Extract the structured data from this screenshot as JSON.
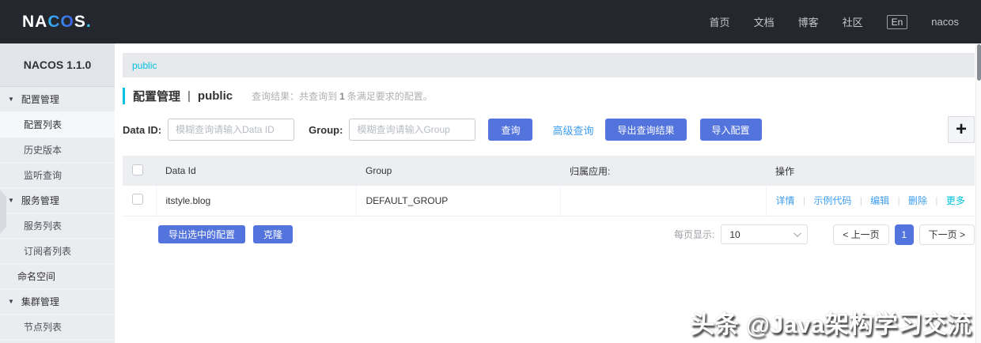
{
  "colors": {
    "topbar-bg": "#24282e",
    "accent": "#5373dd",
    "link": "#3d9df0",
    "cyan": "#00c1de",
    "sidebar-bg": "#eaecf0",
    "table-header-bg": "#eceef1"
  },
  "topbar": {
    "logo": {
      "na": "NA",
      "co": "CO",
      "s": "S",
      "dot": "."
    },
    "links": [
      "首页",
      "文档",
      "博客",
      "社区"
    ],
    "lang": "En",
    "user": "nacos"
  },
  "sidebar": {
    "version": "NACOS 1.1.0",
    "caret": "▼",
    "items": [
      {
        "label": "配置管理",
        "type": "group"
      },
      {
        "label": "配置列表",
        "type": "sub",
        "selected": true
      },
      {
        "label": "历史版本",
        "type": "sub"
      },
      {
        "label": "监听查询",
        "type": "sub"
      },
      {
        "label": "服务管理",
        "type": "group"
      },
      {
        "label": "服务列表",
        "type": "sub"
      },
      {
        "label": "订阅者列表",
        "type": "sub"
      },
      {
        "label": "命名空间",
        "type": "top"
      },
      {
        "label": "集群管理",
        "type": "group"
      },
      {
        "label": "节点列表",
        "type": "sub"
      }
    ]
  },
  "main": {
    "namespace_tab": "public",
    "title": "配置管理",
    "title_sep": "|",
    "title_namespace": "public",
    "result_prefix": "查询结果：共查询到",
    "result_count": "1",
    "result_suffix": "条满足要求的配置。",
    "search": {
      "data_id_label": "Data ID:",
      "data_id_placeholder": "模糊查询请输入Data ID",
      "group_label": "Group:",
      "group_placeholder": "模糊查询请输入Group",
      "query_button": "查询",
      "advanced_link": "高级查询",
      "export_button": "导出查询结果",
      "import_button": "导入配置",
      "add_button": "+"
    },
    "table": {
      "headers": [
        "Data Id",
        "Group",
        "归属应用:",
        "操作"
      ],
      "action_sep": "|",
      "rows": [
        {
          "data_id": "itstyle.blog",
          "group": "DEFAULT_GROUP",
          "app": "",
          "actions": [
            "详情",
            "示例代码",
            "编辑",
            "删除",
            "更多"
          ]
        }
      ]
    },
    "footer": {
      "export_selected_button": "导出选中的配置",
      "clone_button": "克隆",
      "page_size_label": "每页显示:",
      "page_size_value": "10",
      "prev_button": "< 上一页",
      "current_page": "1",
      "next_button": "下一页 >"
    }
  },
  "watermark": "头条 @Java架构学习交流"
}
